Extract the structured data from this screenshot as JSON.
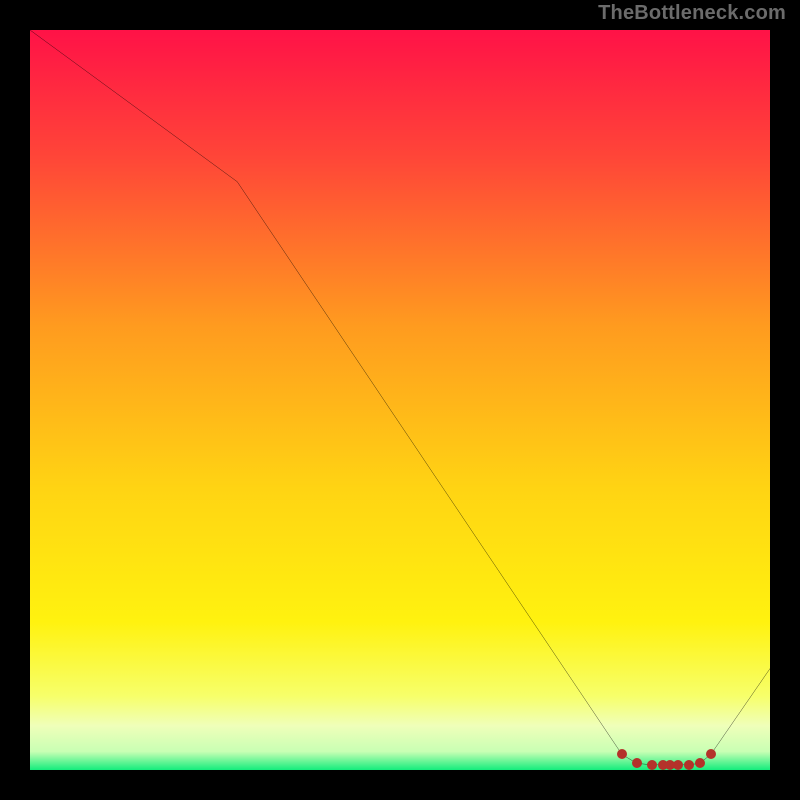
{
  "attribution": "TheBottleneck.com",
  "gradient_stops": [
    {
      "offset": 0,
      "color": "#ff1247"
    },
    {
      "offset": 0.17,
      "color": "#ff4538"
    },
    {
      "offset": 0.4,
      "color": "#ff9b1f"
    },
    {
      "offset": 0.62,
      "color": "#ffd413"
    },
    {
      "offset": 0.8,
      "color": "#fff20f"
    },
    {
      "offset": 0.9,
      "color": "#f7ff6a"
    },
    {
      "offset": 0.94,
      "color": "#efffb9"
    },
    {
      "offset": 0.975,
      "color": "#c9ffb4"
    },
    {
      "offset": 1.0,
      "color": "#14ed7c"
    }
  ],
  "chart_data": {
    "type": "line",
    "title": "",
    "xlabel": "",
    "ylabel": "",
    "xlim": [
      0,
      100
    ],
    "ylim": [
      0,
      100
    ],
    "x": [
      0,
      28,
      80,
      82,
      84,
      85.5,
      86.5,
      87.5,
      89,
      90.5,
      92,
      100
    ],
    "values": [
      100,
      79.5,
      2.1,
      0.9,
      0.7,
      0.7,
      0.7,
      0.7,
      0.7,
      0.9,
      2.1,
      13.7
    ],
    "marker_x": [
      80,
      82,
      84,
      85.5,
      86.5,
      87.5,
      89,
      90.5,
      92
    ],
    "marker_y": [
      2.1,
      0.9,
      0.7,
      0.7,
      0.7,
      0.7,
      0.7,
      0.9,
      2.1
    ]
  }
}
